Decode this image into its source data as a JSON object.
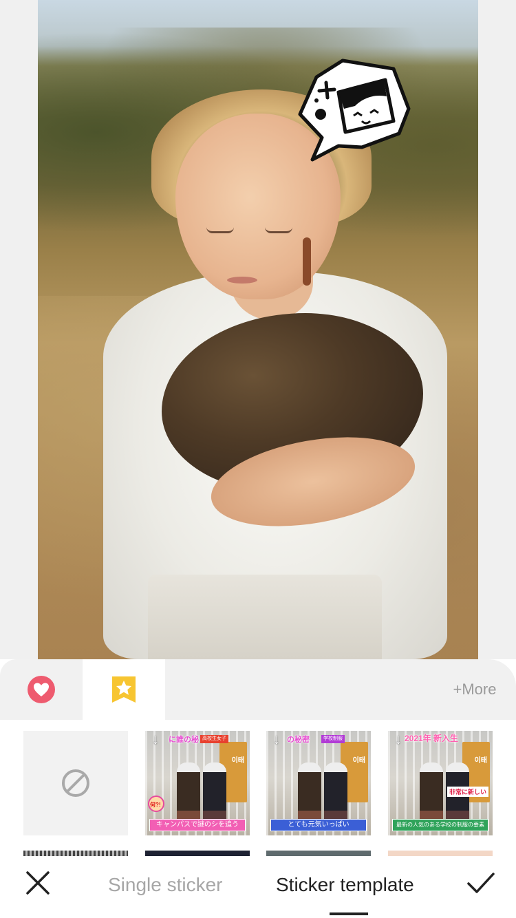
{
  "category_tabs": {
    "favorites_icon": "heart-icon",
    "starred_icon": "star-bookmark-icon",
    "more_label": "+More"
  },
  "sticker_grid": {
    "none_icon": "no-sticker-icon",
    "items": [
      {
        "headline": "に誰の秘",
        "top_banner": "高校生女子",
        "sign": "이태",
        "caption": "キャンパスで謎のシを追う",
        "badge": "何?!"
      },
      {
        "headline": "の秘密",
        "top_banner": "学校制服",
        "sign": "이태",
        "caption": "とても元気いっぱい"
      },
      {
        "headline": "2021年 新入生",
        "top_banner": "",
        "sign": "이태",
        "caption": "最新の人気のある学校の制服の要素",
        "side_note": "非常に新しい"
      }
    ]
  },
  "toolbar": {
    "close_icon": "close-icon",
    "single_label": "Single sticker",
    "template_label": "Sticker template",
    "confirm_icon": "checkmark-icon"
  },
  "colors": {
    "favorites_accent": "#ee5b6f",
    "starred_accent": "#f7c531",
    "active_text": "#222222",
    "inactive_text": "#a6a6a6"
  }
}
